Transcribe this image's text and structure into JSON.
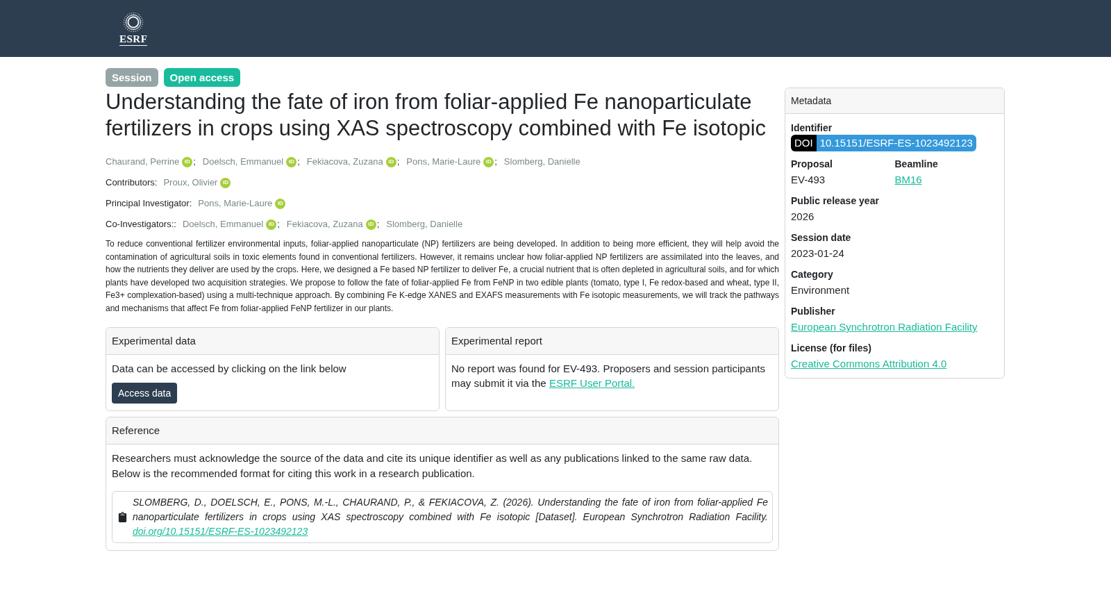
{
  "header": {
    "logo_text": "ESRF"
  },
  "badges": [
    {
      "label": "Session",
      "color": "#95a5a6"
    },
    {
      "label": "Open access",
      "color": "#18bc9c"
    }
  ],
  "title": "Understanding the fate of iron from foliar-applied Fe nanoparticulate fertilizers in crops using XAS spectroscopy combined with Fe isotopic",
  "name_separator": ";",
  "authors": [
    {
      "name": "Chaurand, Perrine",
      "orcid": "iD"
    },
    {
      "name": "Doelsch, Emmanuel",
      "orcid": "iD"
    },
    {
      "name": "Fekiacova, Zuzana",
      "orcid": "iD"
    },
    {
      "name": "Pons, Marie-Laure",
      "orcid": "iD"
    },
    {
      "name": "Slomberg, Danielle"
    }
  ],
  "people_groups": [
    {
      "label": "Contributors:",
      "people": [
        {
          "name": "Proux, Olivier",
          "orcid": "iD"
        }
      ]
    },
    {
      "label": "Principal Investigator:",
      "people": [
        {
          "name": "Pons, Marie-Laure",
          "orcid": "iD"
        }
      ]
    },
    {
      "label": "Co-Investigators::",
      "people": [
        {
          "name": "Doelsch, Emmanuel",
          "orcid": "iD"
        },
        {
          "name": "Fekiacova, Zuzana",
          "orcid": "iD"
        },
        {
          "name": "Slomberg, Danielle"
        }
      ]
    }
  ],
  "abstract": "To reduce conventional fertilizer environmental inputs, foliar-applied nanoparticulate (NP) fertilizers are being developed. In addition to being more efficient, they will help avoid the contamination of agricultural soils in toxic elements found in conventional fertilizers. However, it remains unclear how foliar-applied NP fertilizers are assimilated into the leaves, and how the nutrients they deliver are used by the crops. Here, we designed a Fe based NP fertilizer to deliver Fe, a crucial nutrient that is often depleted in agricultural soils, and for which plants have developed two acquisition strategies. We propose to follow the fate of foliar-applied Fe from FeNP in two edible plants (tomato, type I, Fe redox-based and wheat, type II, Fe3+ complexation-based) using a multi-technique approach. By combining Fe K-edge XANES and EXAFS measurements with Fe isotopic measurements, we will track the pathways and mechanisms that affect Fe from foliar-applied FeNP fertilizer in our plants.",
  "experimental_data": {
    "title": "Experimental data",
    "text": "Data can be accessed by clicking on the link below",
    "button": "Access data"
  },
  "experimental_report": {
    "title": "Experimental report",
    "text": "No report was found for EV-493. Proposers and session participants may submit it via the",
    "link": "ESRF User Portal."
  },
  "reference": {
    "title": "Reference",
    "lines": [
      "Researchers must acknowledge the source of the data and cite its unique identifier as well as any publications linked to the same raw data.",
      "Below is the recommended format for citing this work in a research publication."
    ],
    "citation": "SLOMBERG, D., DOELSCH, E., PONS, M.-L., CHAURAND, P., & FEKIACOVA, Z. (2026). Understanding the fate of iron from foliar-applied Fe nanoparticulate fertilizers in crops using XAS spectroscopy combined with Fe isotopic [Dataset]. European Synchrotron Radiation Facility.",
    "citation_link": "doi.org/10.15151/ESRF-ES-1023492123"
  },
  "metadata": {
    "title": "Metadata",
    "identifier_label": "Identifier",
    "doi_prefix": "DOI",
    "doi": "10.15151/ESRF-ES-1023492123",
    "rows": [
      [
        {
          "label": "Proposal",
          "value": "EV-493",
          "kind": "text"
        },
        {
          "label": "Beamline",
          "value": "BM16",
          "kind": "link"
        }
      ],
      [
        {
          "label": "Public release year",
          "value": "2026",
          "kind": "text"
        }
      ],
      [
        {
          "label": "Session date",
          "value": "2023-01-24",
          "kind": "text"
        }
      ],
      [
        {
          "label": "Category",
          "value": "Environment",
          "kind": "text"
        }
      ],
      [
        {
          "label": "Publisher",
          "value": "European Synchrotron Radiation Facility",
          "kind": "link"
        }
      ],
      [
        {
          "label": "License (for files)",
          "value": "Creative Commons Attribution 4.0",
          "kind": "link"
        }
      ]
    ]
  }
}
